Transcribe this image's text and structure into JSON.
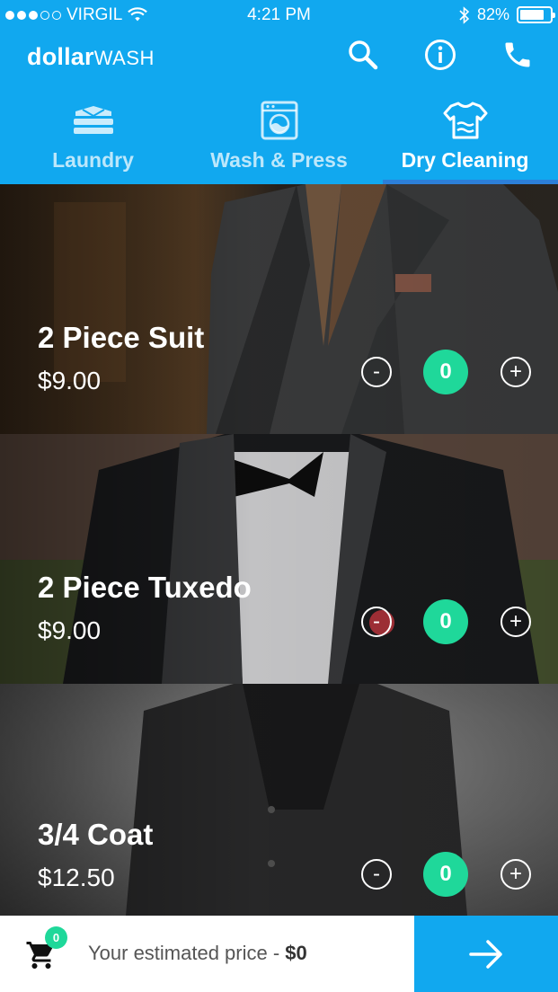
{
  "status_bar": {
    "carrier": "VIRGIL",
    "time": "4:21 PM",
    "battery": "82%",
    "battery_level": 0.82,
    "signal_dots_filled": 3,
    "signal_dots_total": 5
  },
  "header": {
    "brand_bold": "dollar",
    "brand_light": "WASH",
    "icons": [
      "search-icon",
      "info-icon",
      "phone-icon"
    ]
  },
  "tabs": [
    {
      "label": "Laundry",
      "icon": "folded-clothes-icon",
      "active": false
    },
    {
      "label": "Wash & Press",
      "icon": "washing-machine-icon",
      "active": false
    },
    {
      "label": "Dry Cleaning",
      "icon": "shirt-icon",
      "active": true
    }
  ],
  "items": [
    {
      "name": "2 Piece Suit",
      "price": "$9.00",
      "quantity": "0",
      "minus": "-",
      "plus": "+"
    },
    {
      "name": "2 Piece Tuxedo",
      "price": "$9.00",
      "quantity": "0",
      "minus": "-",
      "plus": "+"
    },
    {
      "name": "3/4 Coat",
      "price": "$12.50",
      "quantity": "0",
      "minus": "-",
      "plus": "+"
    }
  ],
  "footer": {
    "cart_count": "0",
    "estimate_prefix": "Your estimated price - ",
    "estimate_value": "$0"
  },
  "colors": {
    "primary": "#11a8ef",
    "accent": "#1fd89a",
    "tab_indicator": "#2c7fd8"
  }
}
